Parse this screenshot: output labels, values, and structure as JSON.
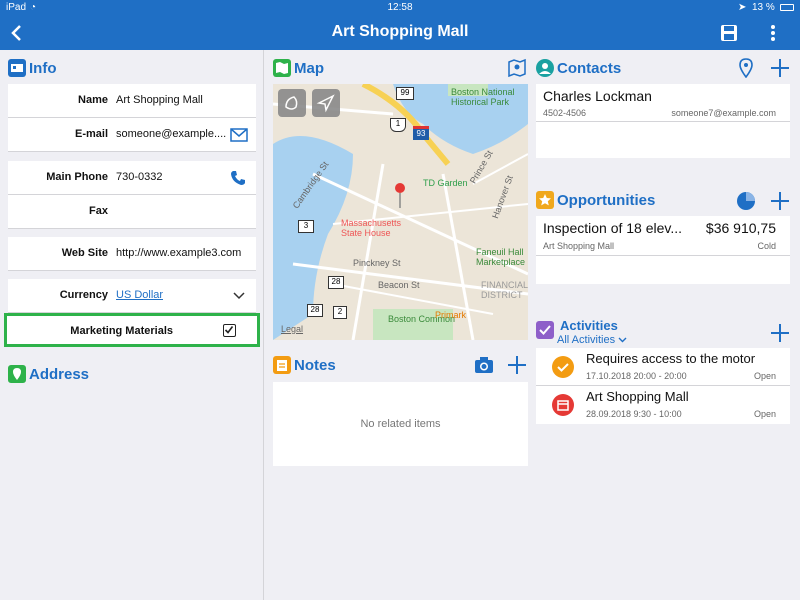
{
  "status": {
    "device": "iPad",
    "time": "12:58",
    "battery": "13 %"
  },
  "nav": {
    "title": "Art Shopping Mall"
  },
  "info": {
    "title": "Info",
    "fields": [
      {
        "label": "Name",
        "value": "Art Shopping Mall"
      },
      {
        "label": "E-mail",
        "value": "someone@example...."
      },
      {
        "label": "Main Phone",
        "value": "730-0332"
      },
      {
        "label": "Fax",
        "value": ""
      },
      {
        "label": "Web Site",
        "value": "http://www.example3.com"
      },
      {
        "label": "Currency",
        "value": "US Dollar"
      }
    ],
    "marketing": {
      "label": "Marketing Materials",
      "checked": true
    }
  },
  "address": {
    "title": "Address"
  },
  "map": {
    "title": "Map",
    "labels": [
      "Boston National Historical Park",
      "TD Garden",
      "Massachusetts State House",
      "Faneuil Hall Marketplace",
      "Boston Common",
      "Primark",
      "FINANCIAL DISTRICT",
      "Beacon St",
      "Pinckney St",
      "Hanover St",
      "Prince St",
      "Cambridge St",
      "Legal"
    ],
    "route_badges": [
      "99",
      "1",
      "93",
      "3",
      "28",
      "28",
      "2"
    ]
  },
  "notes": {
    "title": "Notes",
    "empty": "No related items"
  },
  "contacts": {
    "title": "Contacts",
    "items": [
      {
        "name": "Charles Lockman",
        "phone": "4502-4506",
        "email": "someone7@example.com"
      }
    ]
  },
  "opportunities": {
    "title": "Opportunities",
    "items": [
      {
        "name": "Inspection of 18 elev...",
        "amount": "$36 910,75",
        "account": "Art Shopping Mall",
        "status": "Cold"
      }
    ]
  },
  "activities": {
    "title": "Activities",
    "filter": "All Activities",
    "items": [
      {
        "title": "Requires access to the motor",
        "when": "17.10.2018 20:00 - 20:00",
        "status": "Open",
        "color": "#f39c12"
      },
      {
        "title": "Art Shopping Mall",
        "when": "28.09.2018 9:30 - 10:00",
        "status": "Open",
        "color": "#e53935"
      }
    ]
  },
  "colors": {
    "accent": "#1f6fc5",
    "highlight": "#2eb24a"
  }
}
